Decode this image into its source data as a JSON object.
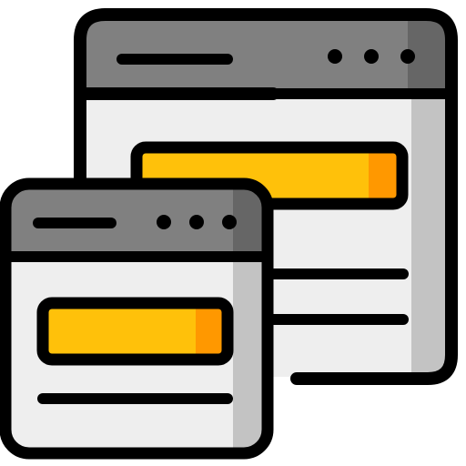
{
  "icon": {
    "name": "browser-windows-icon",
    "description_visible_text": "",
    "colors": {
      "outline": "#000000",
      "titlebar": "#808080",
      "titlebar_shade": "#666666",
      "window_body": "#eeeeee",
      "window_body_shade": "#c3c3c3",
      "bar_fill": "#ffc10a",
      "bar_fill_shade": "#ff9800"
    },
    "windows": [
      {
        "id": "back-window",
        "dots": 3,
        "content_lines": 2
      },
      {
        "id": "front-window",
        "dots": 3,
        "content_lines": 1
      }
    ]
  }
}
